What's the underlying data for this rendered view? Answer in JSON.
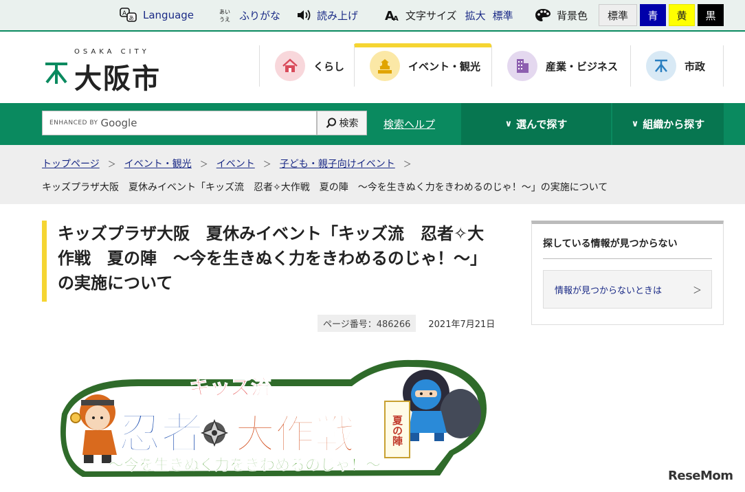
{
  "utility": {
    "language": "Language",
    "furigana": "ふりがな",
    "readaloud": "読み上げ",
    "fontsize_label": "文字サイズ",
    "fontsize_enlarge": "拡大",
    "fontsize_standard": "標準",
    "bgcolor_label": "背景色",
    "bg_standard": "標準",
    "bg_blue": "青",
    "bg_yellow": "黄",
    "bg_black": "黒",
    "colors": {
      "bg_blue": "#0000aa",
      "bg_yellow": "#ffff00",
      "bg_black": "#000000"
    }
  },
  "header": {
    "logo_sub": "OSAKA CITY",
    "logo_main": "大阪市",
    "nav": [
      {
        "label": "くらし",
        "icon": "house-icon",
        "color": "#f8d7db"
      },
      {
        "label": "イベント・観光",
        "icon": "castle-icon",
        "color": "#fbe8a6"
      },
      {
        "label": "産業・ビジネス",
        "icon": "building-icon",
        "color": "#e4d8ef"
      },
      {
        "label": "市政",
        "icon": "city-emblem-icon",
        "color": "#d8e9f5"
      }
    ]
  },
  "search": {
    "enhanced_by": "ENHANCED BY",
    "google": "Google",
    "button": "検索",
    "help": "検索ヘルプ",
    "choose": "選んで探す",
    "org": "組織から探す",
    "brand_green": "#0a8a5f"
  },
  "breadcrumb": {
    "items": [
      "トップページ",
      "イベント・観光",
      "イベント",
      "子ども・親子向けイベント"
    ],
    "current": "キッズプラザ大阪　夏休みイベント「キッズ流　忍者✧大作戦　夏の陣　～今を生きぬく力をきわめるのじゃ！～」の実施について"
  },
  "article": {
    "title_lines": [
      "キッズプラザ大阪　夏休みイベント「キッズ流　忍者✧大",
      "作戦　夏の陣　～今を生きぬく力をきわめるのじゃ！～」",
      "の実施について"
    ],
    "page_number": "ページ番号：486266",
    "date": "2021年7月21日"
  },
  "sidebar": {
    "heading": "探している情報が見つからない",
    "link": "情報が見つからないときは"
  },
  "banner": {
    "title_top": "キッズ流",
    "title_ninja": "忍者",
    "title_daisakusen": "大作戦",
    "title_natsu": "夏の陣",
    "subtitle": "〜今を生きぬく力をきわめるのじゃ！〜"
  },
  "watermark": "ReseMom"
}
